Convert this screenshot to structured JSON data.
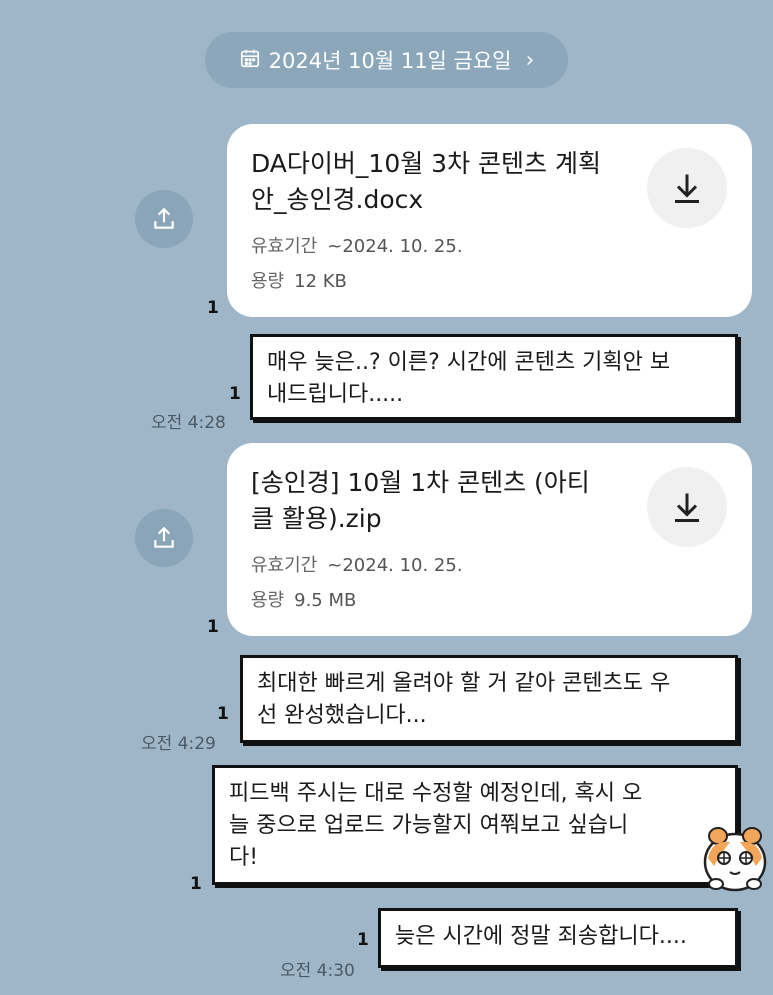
{
  "date_divider": {
    "label": "2024년 10월 11일 금요일",
    "chevron": "›",
    "icon": "calendar-icon"
  },
  "files": [
    {
      "name_line1": "DA다이버_10월 3차 콘텐츠 계획",
      "name_line2": "안_송인경.docx",
      "expiry_label": "유효기간",
      "expiry_value": "~2024. 10. 25.",
      "size_label": "용량",
      "size_value": "12 KB",
      "unread": "1"
    },
    {
      "name_line1": "[송인경] 10월 1차 콘텐츠 (아티",
      "name_line2": "클 활용).zip",
      "expiry_label": "유효기간",
      "expiry_value": "~2024. 10. 25.",
      "size_label": "용량",
      "size_value": "9.5 MB",
      "unread": "1"
    }
  ],
  "messages": [
    {
      "line1": "매우 늦은..? 이른? 시간에 콘텐츠 기획안 보",
      "line2": "내드립니다.....",
      "unread": "1",
      "time": "오전 4:28"
    },
    {
      "line1": "최대한 빠르게 올려야 할 거 같아 콘텐츠도 우",
      "line2": "선 완성했습니다...",
      "unread": "1",
      "time": "오전 4:29"
    },
    {
      "line1": "피드백 주시는 대로 수정할 예정인데, 혹시 오",
      "line2": "늘 중으로 업로드 가능할지 여쭤보고 싶습니",
      "line3": "다!",
      "unread": "1"
    },
    {
      "line1": "늦은 시간에 정말 죄송합니다....",
      "unread": "1",
      "time": "오전 4:30"
    }
  ],
  "colors": {
    "background": "#9fb6c9",
    "pill": "#8ca6ba",
    "bubble_border": "#111111"
  }
}
